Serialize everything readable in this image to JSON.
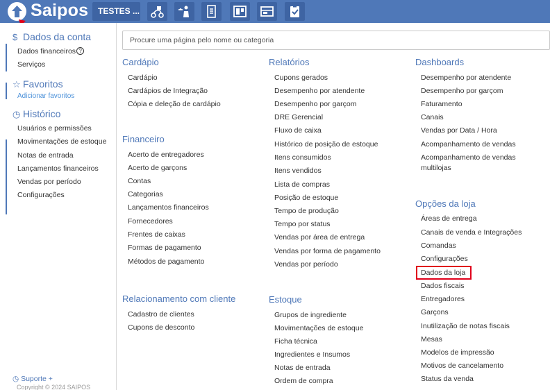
{
  "app": {
    "logo_text": "Saipos",
    "store_button": "TESTES ...",
    "brand_color": "#4f78b8",
    "annotation_color": "#e0001a"
  },
  "toolbar_icons": [
    "delivery-scooter-icon",
    "waiter-tray-icon",
    "order-slip-icon",
    "table-layout-icon",
    "cash-register-icon",
    "checklist-icon"
  ],
  "sidebar": {
    "account": {
      "title": "Dados da conta",
      "icon": "dollar-icon",
      "items": [
        "Dados financeiros",
        "Serviços"
      ]
    },
    "favorites": {
      "title": "Favoritos",
      "icon": "star-icon",
      "add_link": "Adicionar favoritos"
    },
    "history": {
      "title": "Histórico",
      "icon": "clock-icon",
      "items": [
        "Usuários e permissões",
        "Movimentações de estoque",
        "Notas de entrada",
        "Lançamentos financeiros",
        "Vendas por período",
        "Configurações"
      ]
    },
    "support": "Suporte +",
    "copyright": "Copyright © 2024 SAIPOS"
  },
  "search": {
    "placeholder": "Procure uma página pelo nome ou categoria"
  },
  "categories": {
    "cardapio": {
      "title": "Cardápio",
      "items": [
        "Cardápio",
        "Cardápios de Integração",
        "Cópia e deleção de cardápio"
      ]
    },
    "financeiro": {
      "title": "Financeiro",
      "items": [
        "Acerto de entregadores",
        "Acerto de garçons",
        "Contas",
        "Categorias",
        "Lançamentos financeiros",
        "Fornecedores",
        "Frentes de caixas",
        "Formas de pagamento",
        "Métodos de pagamento"
      ]
    },
    "relacionamento": {
      "title": "Relacionamento com cliente",
      "items": [
        "Cadastro de clientes",
        "Cupons de desconto"
      ]
    },
    "relatorios": {
      "title": "Relatórios",
      "items": [
        "Cupons gerados",
        "Desempenho por atendente",
        "Desempenho por garçom",
        "DRE Gerencial",
        "Fluxo de caixa",
        "Histórico de posição de estoque",
        "Itens consumidos",
        "Itens vendidos",
        "Lista de compras",
        "Posição de estoque",
        "Tempo de produção",
        "Tempo por status",
        "Vendas por área de entrega",
        "Vendas por forma de pagamento",
        "Vendas por período"
      ]
    },
    "estoque": {
      "title": "Estoque",
      "items": [
        "Grupos de ingrediente",
        "Movimentações de estoque",
        "Ficha técnica",
        "Ingredientes e Insumos",
        "Notas de entrada",
        "Ordem de compra"
      ]
    },
    "dashboards": {
      "title": "Dashboards",
      "items": [
        "Desempenho por atendente",
        "Desempenho por garçom",
        "Faturamento",
        "Canais",
        "Vendas por Data / Hora",
        "Acompanhamento de vendas",
        "Acompanhamento de vendas",
        "multilojas"
      ]
    },
    "opcoes_loja": {
      "title": "Opções da loja",
      "items": [
        "Áreas de entrega",
        "Canais de venda e Integrações",
        "Comandas",
        "Configurações",
        "Dados da loja",
        "Dados fiscais",
        "Entregadores",
        "Garçons",
        "Inutilização de notas fiscais",
        "Mesas",
        "Modelos de impressão",
        "Motivos de cancelamento",
        "Status da venda"
      ]
    }
  }
}
